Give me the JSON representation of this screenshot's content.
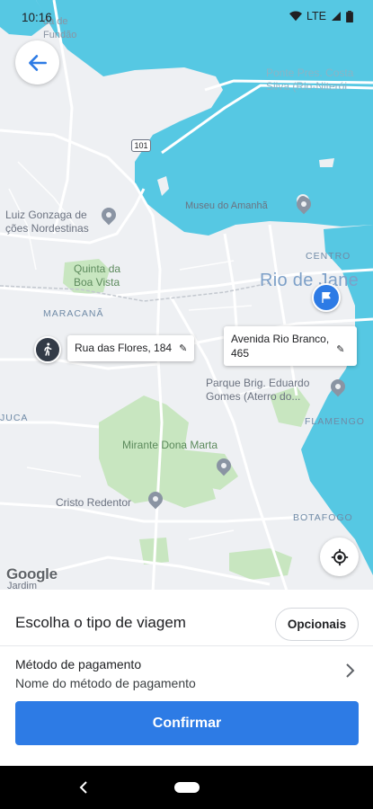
{
  "status_bar": {
    "time": "10:16",
    "network": "LTE"
  },
  "map": {
    "labels": {
      "area_top_left": "da de\nFundão",
      "bridge": "Ponte Pres. Costa\nSilva (Rio-Niterói",
      "route_badge": "101",
      "museum": "Museu do Amanhã",
      "luiz_gonzaga": "Luiz Gonzaga de\nções Nordestinas",
      "centro": "CENTRO",
      "city": "Rio de Jane",
      "quinta": "Quinta da\nBoa Vista",
      "maracana": "MARACANÃ",
      "parque": "Parque Brig. Eduardo\nGomes (Aterro do...",
      "juca": "JUCA",
      "flamengo": "FLAMENGO",
      "mirante": "Mirante Dona Marta",
      "cristo": "Cristo Redentor",
      "botafogo": "BOTAFOGO",
      "jardim": "Jardim"
    },
    "origin_label": "Rua das Flores, 184",
    "destination_label": "Avenida Rio Branco,\n465",
    "attribution": "Google"
  },
  "sheet": {
    "trip_title": "Escolha o tipo de viagem",
    "options_button": "Opcionais",
    "payment_title": "Método de pagamento",
    "payment_value": "Nome do método de pagamento",
    "confirm_button": "Confirmar"
  },
  "colors": {
    "accent": "#2d7be5",
    "water": "#56c8e3",
    "map_land": "#eef0f3",
    "park": "#c8e6c0"
  },
  "icons": {
    "back": "arrow-left-icon",
    "edit": "pencil-icon",
    "locate": "my-location-icon",
    "walker": "walking-person-icon",
    "destination": "flag-icon",
    "chevron": "chevron-right-icon"
  }
}
